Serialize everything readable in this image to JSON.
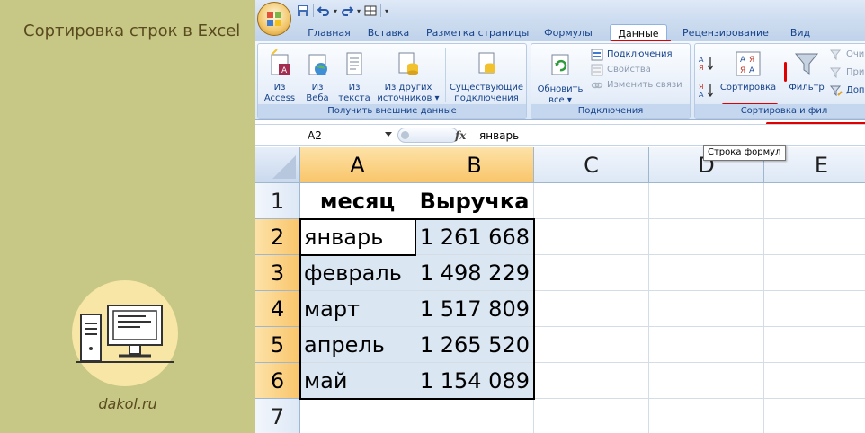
{
  "banner": {
    "title": "Сортировка строк в Excel",
    "site": "dakol.ru",
    "circle_color": "#f7e6a6",
    "bg_color": "#c8c886"
  },
  "tabs": [
    "Главная",
    "Вставка",
    "Разметка страницы",
    "Формулы",
    "Данные",
    "Рецензирование",
    "Вид"
  ],
  "active_tab": "Данные",
  "ribbon": {
    "external_data": {
      "buttons": [
        {
          "line1": "Из",
          "line2": "Access",
          "icon": "access-icon"
        },
        {
          "line1": "Из",
          "line2": "Веба",
          "icon": "web-icon"
        },
        {
          "line1": "Из",
          "line2": "текста",
          "icon": "text-file-icon"
        },
        {
          "line1": "Из других",
          "line2": "источников ▾",
          "icon": "database-icon"
        },
        {
          "line1": "Существующие",
          "line2": "подключения",
          "icon": "existing-connections-icon"
        }
      ],
      "label": "Получить внешние данные"
    },
    "connections": {
      "refresh_line1": "Обновить",
      "refresh_line2": "все ▾",
      "items": [
        "Подключения",
        "Свойства",
        "Изменить связи"
      ],
      "label": "Подключения"
    },
    "sort_filter": {
      "sort": "Сортировка",
      "filter": "Фильтр",
      "small_items": [
        "Очи",
        "При",
        "Доп"
      ],
      "label": "Сортировка и фил"
    }
  },
  "formula_bar": {
    "name_box": "A2",
    "fx": "fx",
    "value": "январь",
    "tooltip": "Строка формул"
  },
  "sheet": {
    "columns": [
      "A",
      "B",
      "C",
      "D",
      "E"
    ],
    "rows": [
      "1",
      "2",
      "3",
      "4",
      "5",
      "6",
      "7"
    ],
    "cells": [
      [
        "месяц",
        "Выручка"
      ],
      [
        "январь",
        "1 261 668"
      ],
      [
        "февраль",
        "1 498 229"
      ],
      [
        "март",
        "1 517 809"
      ],
      [
        "апрель",
        "1 265 520"
      ],
      [
        "май",
        "1 154 089"
      ],
      [
        "",
        ""
      ]
    ]
  },
  "colors": {
    "accent_red": "#e00000",
    "selected_header": "#f9c56a",
    "selection_fill": "#dbe6f3"
  }
}
